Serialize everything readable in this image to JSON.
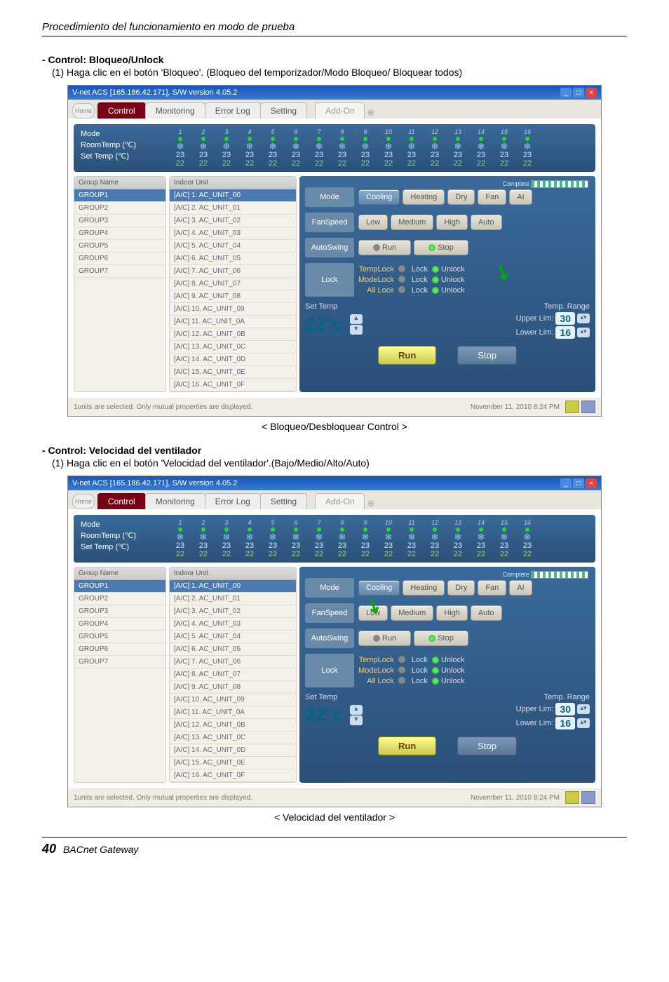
{
  "header": "Procedimiento del funcionamiento en modo de prueba",
  "section1": {
    "title": "- Control: Bloqueo/Unlock",
    "desc": "(1) Haga clic en el botón 'Bloqueo'. (Bloqueo del temporizador/Modo Bloqueo/ Bloquear todos)",
    "caption": "< Bloqueo/Desbloquear Control >"
  },
  "section2": {
    "title": "- Control: Velocidad del ventilador",
    "desc": "(1) Haga clic en el botón 'Velocidad del ventilador'.(Bajo/Medio/Alto/Auto)",
    "caption": "< Velocidad del ventilador >"
  },
  "window": {
    "title": "V-net ACS [165.186.42.171],   S/W version 4.05.2"
  },
  "tabs": {
    "home": "Home",
    "items": [
      "Control",
      "Monitoring",
      "Error Log",
      "Setting",
      "Add-On"
    ]
  },
  "status": {
    "labels": [
      "Mode",
      "RoomTemp (℃)",
      "Set Temp   (℃)"
    ],
    "cols": 16,
    "roomtemp": "23",
    "settemp": "22"
  },
  "groupPanel": {
    "head": "Group Name",
    "items": [
      "GROUP1",
      "GROUP2",
      "GROUP3",
      "GROUP4",
      "GROUP5",
      "GROUP6",
      "GROUP7"
    ]
  },
  "unitPanel": {
    "head": "Indoor Unit",
    "items": [
      "[A/C] 1. AC_UNIT_00",
      "[A/C] 2. AC_UNIT_01",
      "[A/C] 3. AC_UNIT_02",
      "[A/C] 4. AC_UNIT_03",
      "[A/C] 5. AC_UNIT_04",
      "[A/C] 6. AC_UNIT_05",
      "[A/C] 7. AC_UNIT_06",
      "[A/C] 8. AC_UNIT_07",
      "[A/C] 9. AC_UNIT_08",
      "[A/C] 10. AC_UNIT_09",
      "[A/C] 11. AC_UNIT_0A",
      "[A/C] 12. AC_UNIT_0B",
      "[A/C] 13. AC_UNIT_0C",
      "[A/C] 14. AC_UNIT_0D",
      "[A/C] 15. AC_UNIT_0E",
      "[A/C] 16. AC_UNIT_0F"
    ]
  },
  "ctrl": {
    "complete": "Complete",
    "mode": {
      "label": "Mode",
      "opts": [
        "Cooling",
        "Heating",
        "Dry",
        "Fan",
        "AI"
      ]
    },
    "fan": {
      "label": "FanSpeed",
      "opts": [
        "Low",
        "Medium",
        "High",
        "Auto"
      ]
    },
    "swing": {
      "label": "AutoSwing",
      "opts": [
        "Run",
        "Stop"
      ]
    },
    "lock": {
      "label": "Lock",
      "rows": [
        [
          "TempLock",
          "Lock",
          "Unlock"
        ],
        [
          "ModeLock",
          "Lock",
          "Unlock"
        ],
        [
          "All Lock",
          "Lock",
          "Unlock"
        ]
      ]
    },
    "settemp": {
      "label": "Set Temp",
      "rangeLabel": "Temp. Range",
      "value": "22",
      "unit": "°c",
      "upper": {
        "l": "Upper Lim:",
        "v": "30"
      },
      "lower": {
        "l": "Lower Lim:",
        "v": "16"
      }
    },
    "run": "Run",
    "stop": "Stop"
  },
  "statusbar": {
    "msg": "1units are selected. Only mutual properties are displayed.",
    "time": "November 11, 2010  8:24 PM"
  },
  "footer": {
    "page": "40",
    "text": "BACnet Gateway"
  }
}
